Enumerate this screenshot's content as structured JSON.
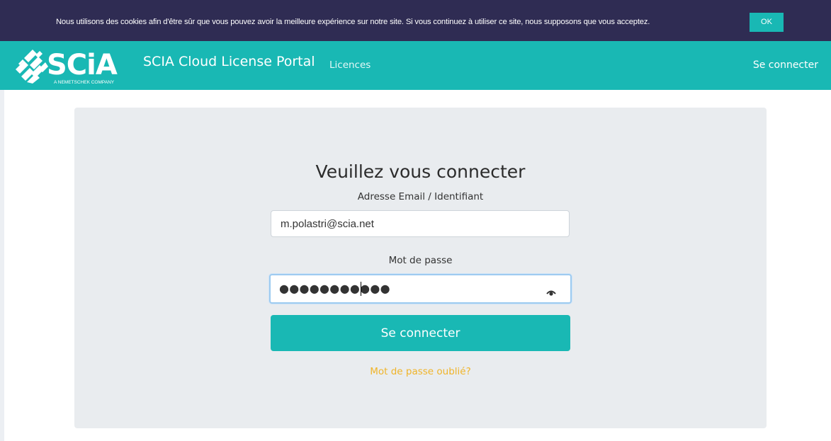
{
  "cookie_bar": {
    "message": "Nous utilisons des cookies afin d'être sûr que vous pouvez avoir la meilleure expérience sur notre site. Si vous continuez à utiliser ce site, nous supposons que vous acceptez.",
    "ok_label": "OK"
  },
  "header": {
    "logo_text": "SCiA",
    "logo_tagline": "A NEMETSCHEK COMPANY",
    "portal_title": "SCIA Cloud License Portal",
    "nav_licences": "Licences",
    "nav_login": "Se connecter"
  },
  "login": {
    "title": "Veuillez vous connecter",
    "email_label": "Adresse Email / Identifiant",
    "email_value": "m.polastri@scia.net",
    "password_label": "Mot de passe",
    "password_value": "●●●●●●●●●●●",
    "submit_label": "Se connecter",
    "forgot_label": "Mot de passe oublié?"
  },
  "icons": {
    "logo": "scia-logo-icon",
    "eye": "eye-icon"
  },
  "colors": {
    "teal": "#19b8b4",
    "cookie_bar": "#2f2c53",
    "card": "#e9ecef",
    "link": "#f0b429"
  }
}
